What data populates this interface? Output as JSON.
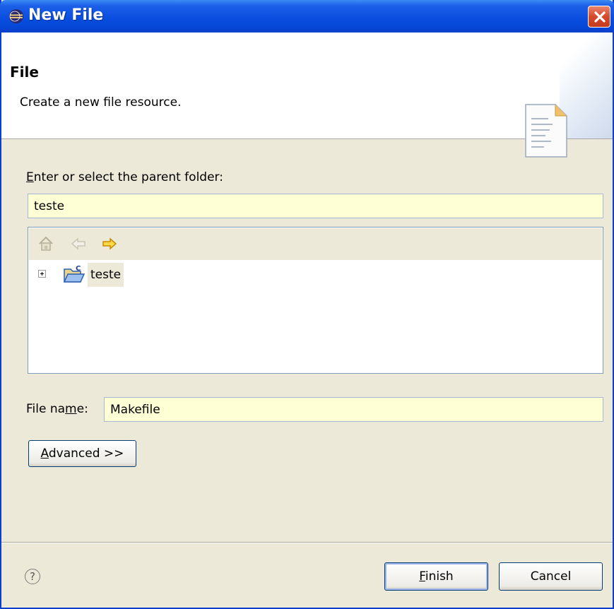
{
  "window": {
    "title": "New File",
    "close_label": "×"
  },
  "banner": {
    "title": "File",
    "description": "Create a new file resource."
  },
  "parent_folder": {
    "label_mnemonic": "E",
    "label_rest": "nter or select the parent folder:",
    "value": "teste"
  },
  "tree": {
    "toolbar": [
      "home-icon",
      "back-icon",
      "forward-icon"
    ],
    "nodes": [
      {
        "label": "teste",
        "icon": "c-project-folder-icon"
      }
    ]
  },
  "file_name": {
    "label_before": "File na",
    "label_mnemonic": "m",
    "label_after": "e:",
    "value": "Makefile"
  },
  "advanced_button": {
    "mnemonic": "A",
    "rest": "dvanced >>"
  },
  "footer": {
    "help_symbol": "?",
    "finish": {
      "mnemonic": "F",
      "rest": "inish"
    },
    "cancel_label": "Cancel"
  }
}
